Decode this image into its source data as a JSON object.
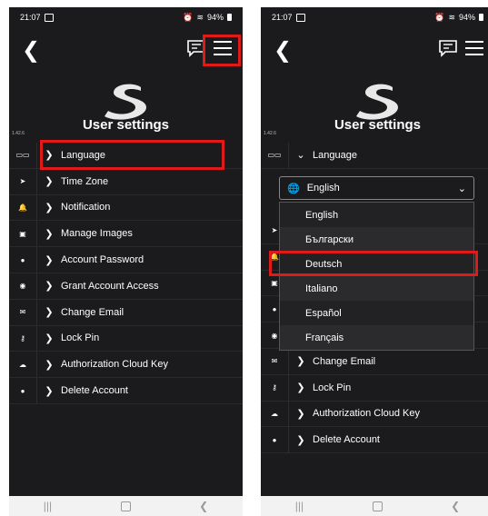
{
  "status": {
    "time": "21:07",
    "battery": "94%"
  },
  "left": {
    "version": "1.42.6",
    "title": "User settings",
    "menu": [
      {
        "icon": "id-card-icon",
        "glyph": "▭▭",
        "label": "Language"
      },
      {
        "icon": "location-arrow-icon",
        "glyph": "➤",
        "label": "Time Zone"
      },
      {
        "icon": "bell-icon",
        "glyph": "🔔",
        "label": "Notification"
      },
      {
        "icon": "image-icon",
        "glyph": "▣",
        "label": "Manage Images"
      },
      {
        "icon": "user-icon",
        "glyph": "●",
        "label": "Account Password"
      },
      {
        "icon": "globe-icon",
        "glyph": "◉",
        "label": "Grant Account Access"
      },
      {
        "icon": "envelope-icon",
        "glyph": "✉",
        "label": "Change Email"
      },
      {
        "icon": "key-icon",
        "glyph": "⚷",
        "label": "Lock Pin"
      },
      {
        "icon": "cloud-icon",
        "glyph": "☁",
        "label": "Authorization Cloud Key"
      },
      {
        "icon": "user-times-icon",
        "glyph": "●",
        "label": "Delete Account"
      }
    ]
  },
  "right": {
    "version": "1.42.6",
    "title": "User settings",
    "expanded_label": "Language",
    "select_value": "English",
    "options": [
      "English",
      "Български",
      "Deutsch",
      "Italiano",
      "Español",
      "Français"
    ],
    "visible_rows_below": [
      "Change Email",
      "Lock Pin",
      "Authorization Cloud Key",
      "Delete Account"
    ]
  },
  "colors": {
    "background": "#1b1b1d",
    "highlight": "#e01919"
  }
}
